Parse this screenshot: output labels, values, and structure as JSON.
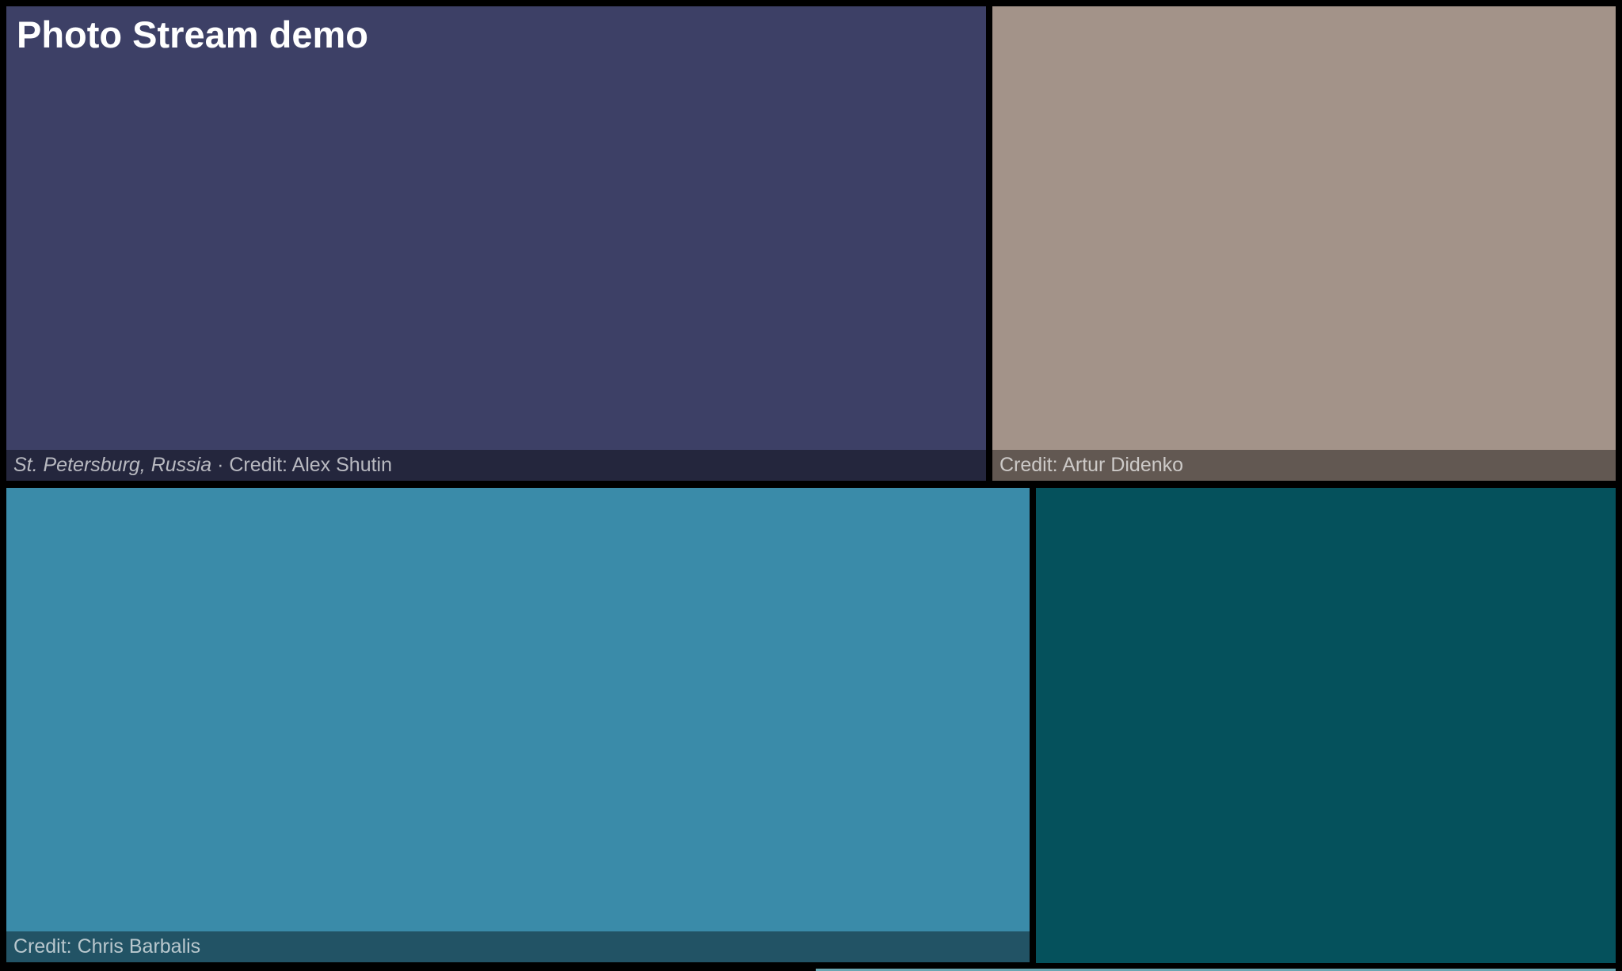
{
  "page": {
    "title": "Photo Stream demo"
  },
  "photos": [
    {
      "color": "#3d4066",
      "location": "St. Petersburg, Russia",
      "separator": " · ",
      "credit": "Credit: Alex Shutin"
    },
    {
      "color": "#a39389",
      "location": "",
      "separator": "",
      "credit": "Credit: Artur Didenko"
    },
    {
      "color": "#3a8ba9",
      "location": "",
      "separator": "",
      "credit": "Credit: Chris Barbalis"
    },
    {
      "color": "#05515c",
      "location": "",
      "separator": "",
      "credit": ""
    },
    {
      "color": "#6aa7b3",
      "location": "",
      "separator": "",
      "credit": ""
    }
  ]
}
